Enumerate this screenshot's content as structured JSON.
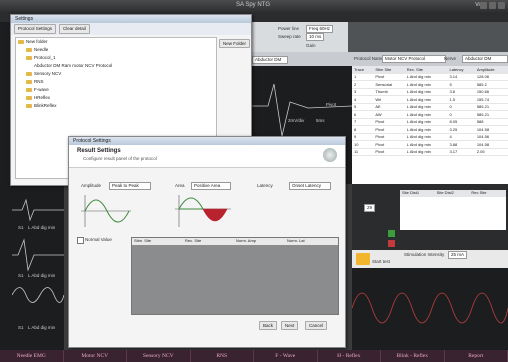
{
  "window": {
    "title": "SA Spy NTG",
    "corner": "View"
  },
  "settings_dialog": {
    "title": "Settings",
    "tab_protocol": "Protocol Settings",
    "tab_clear": "Clear detail",
    "new_folder_button": "New Folder",
    "tree": [
      "New folder",
      "Needle",
      "Protocol_1",
      "Abductor DM Ram motor NCV Protocol",
      "Sensory NCV",
      "RNS",
      "F-wave",
      "HReflex",
      "BlinkReflex"
    ]
  },
  "top_fields": {
    "label_a": "Power line",
    "value_a": "Freq 60Hz",
    "label_b": "Sweep rate",
    "value_b": "10 ms",
    "label_c": "Gain"
  },
  "protocol_bar": {
    "protocol_label": "Protocol Name",
    "protocol_value": "Motor NCV Protocol",
    "nerve_label": "Nerve",
    "nerve_value": "Abductor DM",
    "left_value": "Abductor DM"
  },
  "right_table": {
    "headers": [
      "Trace",
      "Stim Site",
      "Rec. Site",
      "Latency",
      "Amplitude"
    ],
    "rows": [
      [
        "1",
        "Pivot",
        "L Abd dig min",
        "3.14",
        "128.06"
      ],
      [
        "2",
        "Sensorial",
        "L Abd dig min",
        "5",
        "585.2"
      ],
      [
        "3",
        "Thumb",
        "L Abd dig min",
        "3.8",
        "150.66"
      ],
      [
        "4",
        "Wri",
        "L Abd dig min",
        "1.5",
        "155.74"
      ],
      [
        "5",
        "AE",
        "L Abd dig min",
        "0",
        "585.21"
      ],
      [
        "6",
        "AW",
        "L Abd dig min",
        "0",
        "585.21"
      ],
      [
        "7",
        "Pivot",
        "L Abd dig min",
        "8.05",
        "588"
      ],
      [
        "8",
        "Pivot",
        "L Abd dig min",
        "3.25",
        "104.58"
      ],
      [
        "9",
        "Pivot",
        "L Abd dig min",
        "4",
        "104.56"
      ],
      [
        "10",
        "Pivot",
        "L Abd dig min",
        "3.88",
        "104.58"
      ],
      [
        "11",
        "Pivot",
        "L Abd dig min",
        "3.17",
        "2.05"
      ]
    ]
  },
  "small_table": {
    "headers": [
      "Site Dist1",
      "Site Dist2",
      "Rec Site"
    ],
    "value": "29"
  },
  "waveform_labels": {
    "sens": "2mV/div",
    "time": "5ms",
    "trace_a": "Pivot",
    "trace_b": "Pivot",
    "row1": "S1",
    "row2": "S1",
    "row3": "S1",
    "row_label": "L Abd dig min"
  },
  "bottom_controls": {
    "stim_label": "Stimulation Intensity",
    "stim_value": "25 mA",
    "start_label": "Start test"
  },
  "result_dialog": {
    "title": "Protocol Settings",
    "heading": "Result Settings",
    "subtitle": "Configure result panel of the protocol",
    "amplitude_label": "Amplitude",
    "amplitude_value": "Peak to Peak",
    "area_label": "Area",
    "area_value": "Positive Area",
    "latency_label": "Latency",
    "latency_value": "Onset Latency",
    "normal_value_label": "Normal Value",
    "table_headers": [
      "Stim. Site",
      "Rec. Site",
      "Norm. Amp",
      "Norm. Lat"
    ],
    "buttons": [
      "Back",
      "Next",
      "Cancel"
    ]
  },
  "bottom_tabs": [
    "Needle EMG",
    "Motor NCV",
    "Sensory NCV",
    "RNS",
    "F - Wave",
    "H - Reflex",
    "Blink - Reflex",
    "Report"
  ]
}
